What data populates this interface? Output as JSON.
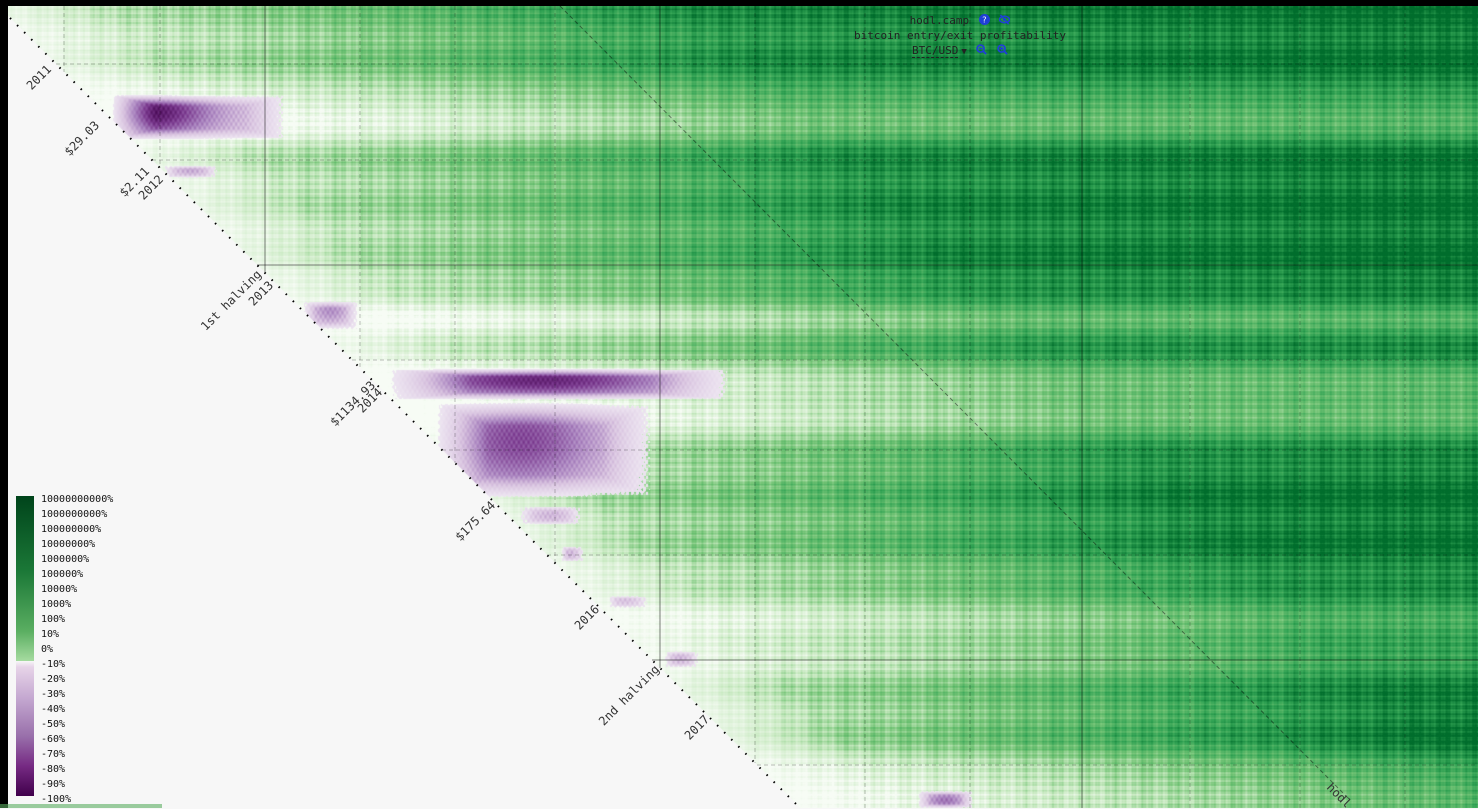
{
  "header": {
    "site": "hodl.camp",
    "subtitle": "bitcoin entry/exit profitability",
    "pair": "BTC/USD"
  },
  "icons": {
    "help": "question-circle-icon",
    "hide": "eye-slash-icon",
    "dropdown": "caret-down-icon",
    "zoom_out": "zoom-out-icon",
    "zoom_in": "zoom-in-icon"
  },
  "legend": {
    "ticks": [
      "10000000000%",
      "1000000000%",
      "100000000%",
      "10000000%",
      "1000000%",
      "100000%",
      "10000%",
      "1000%",
      "100%",
      "10%",
      "0%",
      "-10%",
      "-20%",
      "-30%",
      "-40%",
      "-50%",
      "-60%",
      "-70%",
      "-80%",
      "-90%",
      "-100%"
    ]
  },
  "watermark": "hodl",
  "colors": {
    "gain_max": "#00441b",
    "gain_mid": "#5aae61",
    "gain_low": "#d9f0d3",
    "neutral": "#f7f7f7",
    "loss_low": "#e7d4e8",
    "loss_mid": "#9970ab",
    "loss_max": "#40004b"
  },
  "chart_data": {
    "type": "heatmap",
    "x_axis": "exit date",
    "y_axis": "entry date",
    "value": "profitability percent",
    "color_scale": "diverging log",
    "diagonal_year_labels": [
      "2011",
      "2012",
      "2013",
      "2014",
      "2016",
      "2017"
    ],
    "diagonal_price_labels": [
      "$29.03",
      "$2.11",
      "$1134.93",
      "$175.64"
    ],
    "diagonal_event_labels": [
      "1st halving",
      "2nd halving"
    ],
    "loss_regions": [
      {
        "entry_from": "2011-06",
        "entry_to": "2011-11",
        "exit_from": "2011-06",
        "exit_to": "2012-04",
        "min_pct": -90
      },
      {
        "entry_from": "2013-11",
        "entry_to": "2014-10",
        "exit_from": "2013-11",
        "exit_to": "2016-12",
        "min_pct": -80
      },
      {
        "entry_from": "2017-12",
        "entry_to": "2018-01",
        "exit_from": "2017-12",
        "exit_to": "2018-12",
        "min_pct": -70
      }
    ]
  }
}
